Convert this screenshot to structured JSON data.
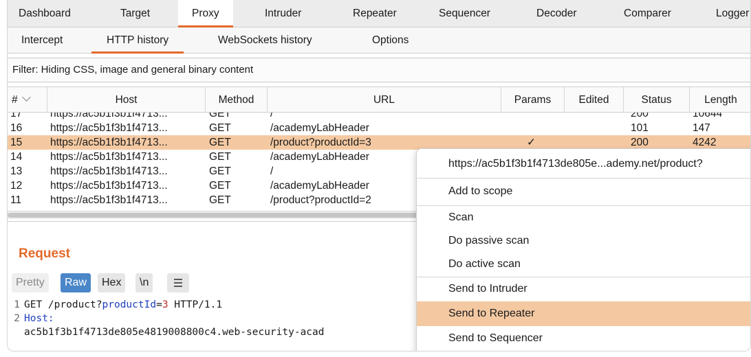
{
  "top_tabs": [
    "Dashboard",
    "Target",
    "Proxy",
    "Intruder",
    "Repeater",
    "Sequencer",
    "Decoder",
    "Comparer",
    "Logger"
  ],
  "sub_tabs": [
    "Intercept",
    "HTTP history",
    "WebSockets history",
    "Options"
  ],
  "filter_text": "Filter: Hiding CSS, image and general binary content",
  "columns": {
    "num": "#",
    "host": "Host",
    "method": "Method",
    "url": "URL",
    "params": "Params",
    "edited": "Edited",
    "status": "Status",
    "length": "Length"
  },
  "rows": [
    {
      "num": "17",
      "host": "https://ac5b1f3b1f4713...",
      "method": "GET",
      "url": "/",
      "params": "",
      "status": "200",
      "length": "10644"
    },
    {
      "num": "16",
      "host": "https://ac5b1f3b1f4713...",
      "method": "GET",
      "url": "/academyLabHeader",
      "params": "",
      "status": "101",
      "length": "147"
    },
    {
      "num": "15",
      "host": "https://ac5b1f3b1f4713...",
      "method": "GET",
      "url": "/product?productId=3",
      "params": "✓",
      "status": "200",
      "length": "4242"
    },
    {
      "num": "14",
      "host": "https://ac5b1f3b1f4713...",
      "method": "GET",
      "url": "/academyLabHeader",
      "params": "",
      "status": "",
      "length": ""
    },
    {
      "num": "13",
      "host": "https://ac5b1f3b1f4713...",
      "method": "GET",
      "url": "/",
      "params": "",
      "status": "",
      "length": ""
    },
    {
      "num": "12",
      "host": "https://ac5b1f3b1f4713...",
      "method": "GET",
      "url": "/academyLabHeader",
      "params": "",
      "status": "",
      "length": ""
    },
    {
      "num": "11",
      "host": "https://ac5b1f3b1f4713...",
      "method": "GET",
      "url": "/product?productId=2",
      "params": "",
      "status": "",
      "length": ""
    }
  ],
  "request": {
    "title": "Request",
    "toolbar": {
      "pretty": "Pretty",
      "raw": "Raw",
      "hex": "Hex",
      "newline": "\\n"
    },
    "lines": {
      "l1_num": "1",
      "l1_method": "GET /product?",
      "l1_param": "productId",
      "l1_eq": "=",
      "l1_val": "3",
      "l1_proto": " HTTP/1.1",
      "l2_num": "2",
      "l2_header": "Host:",
      "l3_text": "ac5b1f3b1f4713de805e4819008800c4.web-security-acad"
    }
  },
  "context_menu": {
    "url": "https://ac5b1f3b1f4713de805e...ademy.net/product?",
    "items": [
      "Add to scope",
      "Scan",
      "Do passive scan",
      "Do active scan",
      "Send to Intruder",
      "Send to Repeater",
      "Send to Sequencer"
    ]
  },
  "colors": {
    "accent": "#e4692a",
    "selection": "#f4c9a2",
    "raw_active": "#4a86c8"
  }
}
